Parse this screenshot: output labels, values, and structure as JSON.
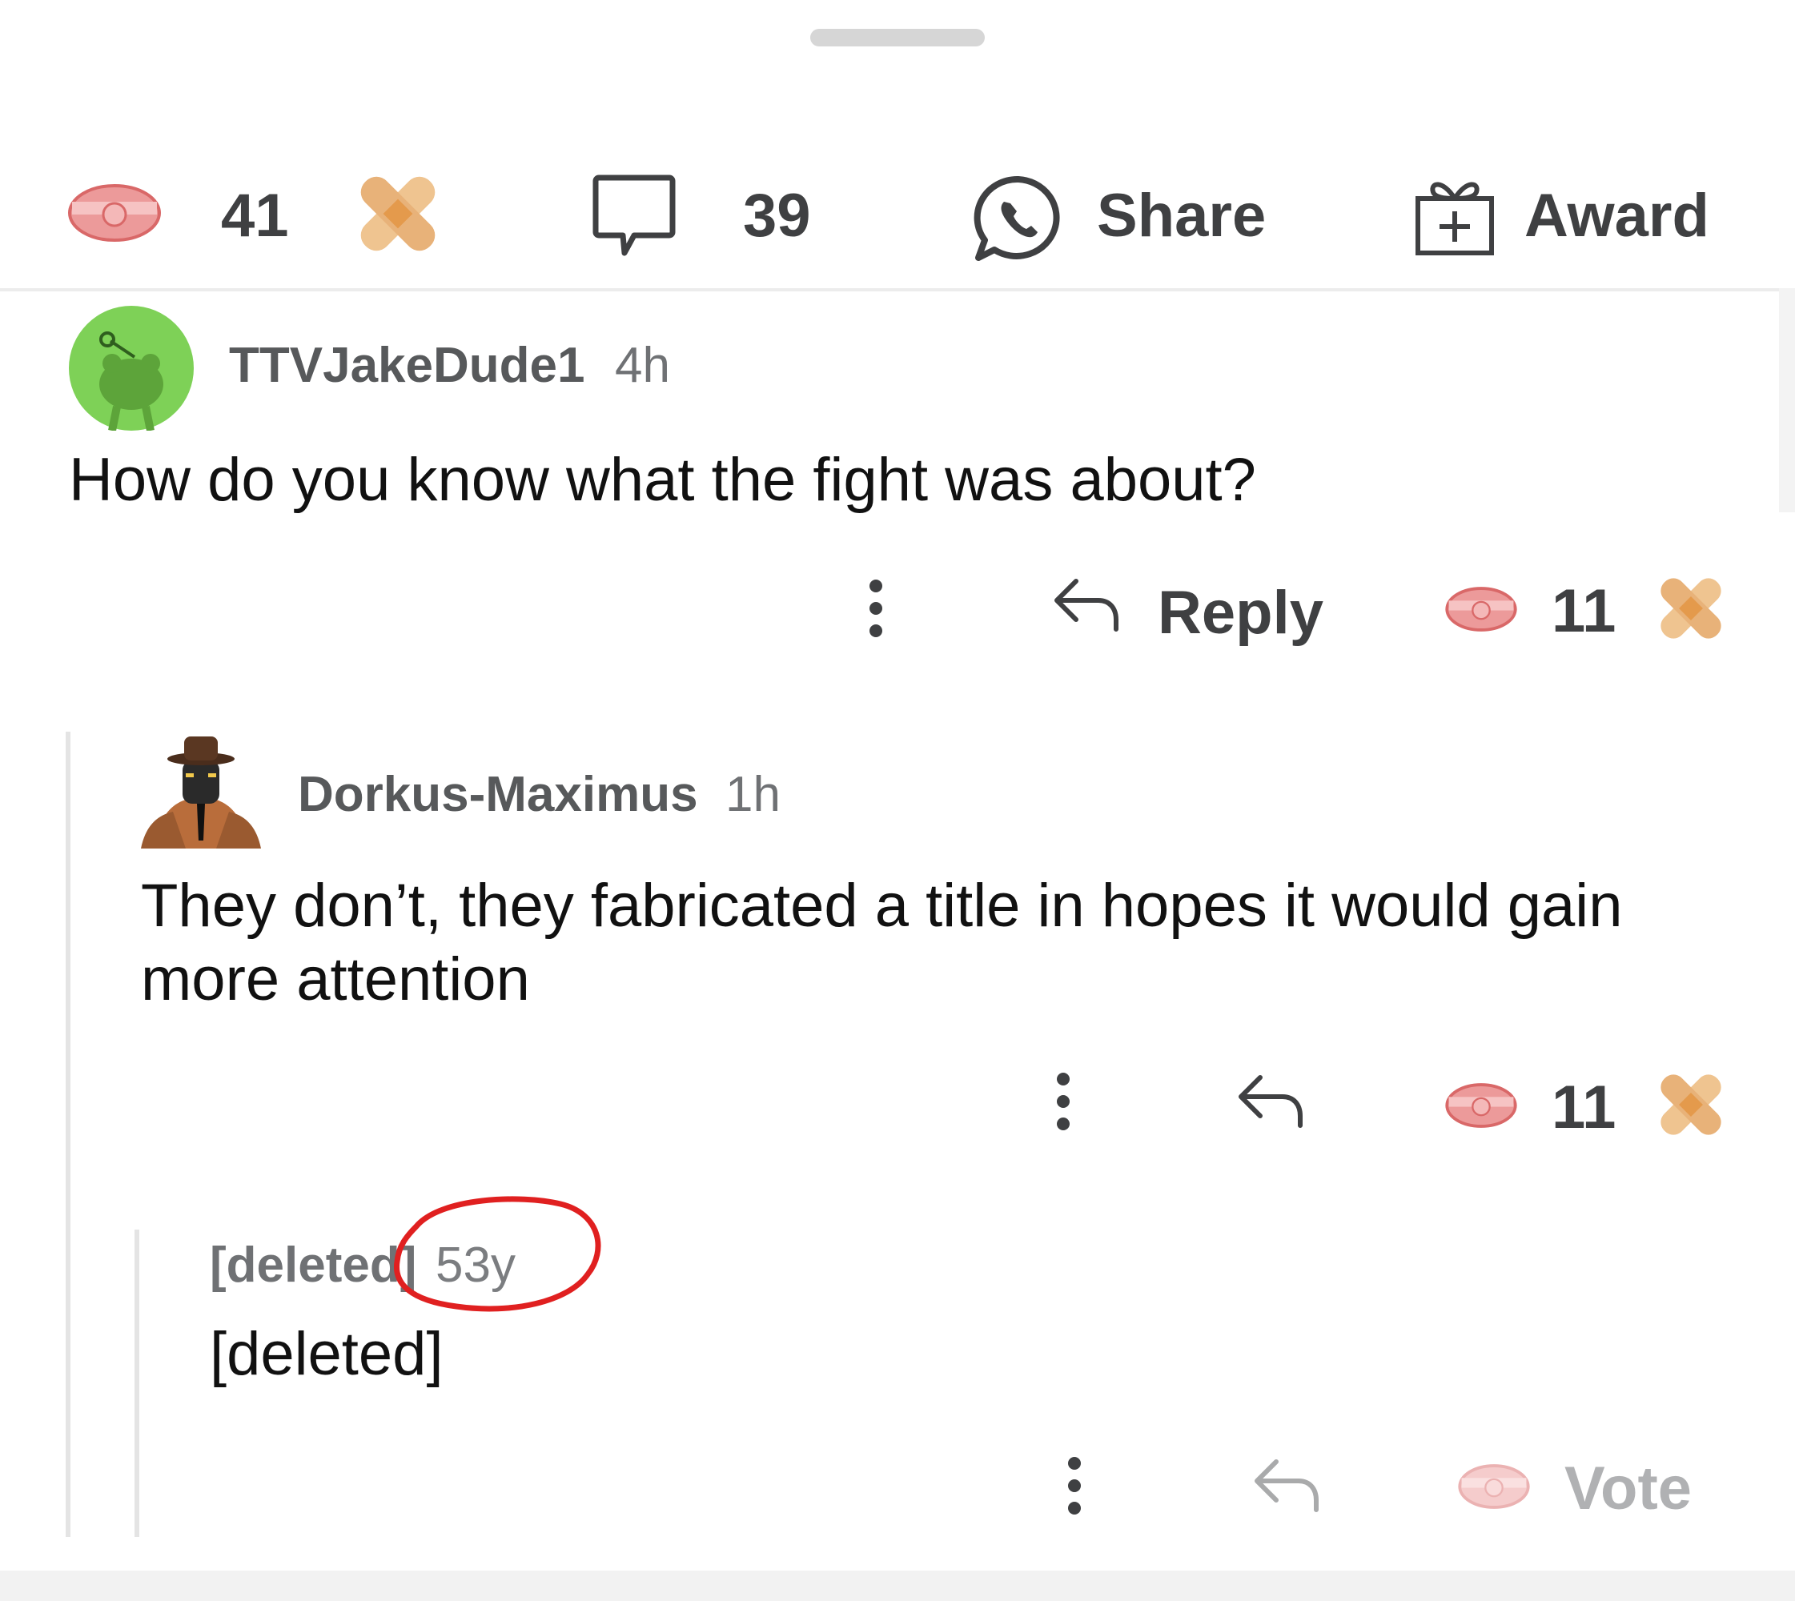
{
  "post_actions": {
    "upvote_count": "41",
    "comment_count": "39",
    "share_label": "Share",
    "award_label": "Award"
  },
  "comments": [
    {
      "username": "TTVJakeDude1",
      "time": "4h",
      "body": "How do you know what the fight was about?",
      "reply_label": "Reply",
      "vote_count": "11"
    },
    {
      "username": "Dorkus-Maximus",
      "time": "1h",
      "body": "They don’t, they fabricated a title in hopes it would gain more attention",
      "vote_count": "11"
    },
    {
      "username": "[deleted]",
      "time": "53y",
      "body": "[deleted]",
      "vote_label": "Vote"
    }
  ],
  "colors": {
    "upvote_red": "#e07a7a",
    "downvote_orange": "#e8a35a",
    "avatar_green": "#7ed157",
    "annotation_red": "#e02020"
  }
}
